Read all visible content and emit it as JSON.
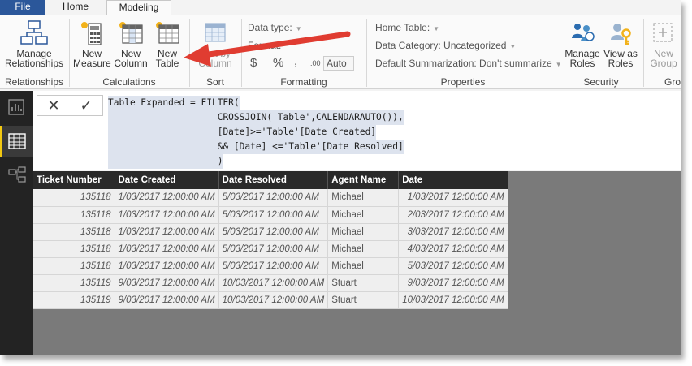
{
  "tabs": {
    "file": "File",
    "home": "Home",
    "modeling": "Modeling"
  },
  "ribbon": {
    "relationships": {
      "btn_line1": "Manage",
      "btn_line2": "Relationships",
      "group": "Relationships"
    },
    "calculations": {
      "new_measure": [
        "New",
        "Measure"
      ],
      "new_column": [
        "New",
        "Column"
      ],
      "new_table": [
        "New",
        "Table"
      ],
      "group": "Calculations"
    },
    "sort": {
      "btn_line1": "Sort by",
      "btn_line2": "Column",
      "group": "Sort"
    },
    "formatting": {
      "data_type": "Data type:",
      "format": "Format:",
      "currency": "$",
      "percent": "%",
      "comma": ",",
      "decimals": ".00",
      "auto": "Auto",
      "group": "Formatting"
    },
    "properties": {
      "home_table": "Home Table:",
      "data_category": "Data Category: Uncategorized",
      "default_summarization": "Default Summarization: Don't summarize",
      "group": "Properties"
    },
    "security": {
      "manage_roles": [
        "Manage",
        "Roles"
      ],
      "view_as_roles": [
        "View as",
        "Roles"
      ],
      "group": "Security"
    },
    "groups": {
      "new_group": [
        "New",
        "Group"
      ],
      "group": "Gro"
    }
  },
  "formula": {
    "cancel": "✕",
    "commit": "✓",
    "lines": [
      "Table Expanded = FILTER(",
      "                    CROSSJOIN('Table',CALENDARAUTO()),",
      "                    [Date]>='Table'[Date Created]",
      "                    && [Date] <='Table'[Date Resolved]",
      "                    )"
    ]
  },
  "table": {
    "headers": [
      "Ticket Number",
      "Date Created",
      "Date Resolved",
      "Agent Name",
      "Date"
    ],
    "rows": [
      [
        "135118",
        "1/03/2017 12:00:00 AM",
        "5/03/2017 12:00:00 AM",
        "Michael",
        "1/03/2017 12:00:00 AM"
      ],
      [
        "135118",
        "1/03/2017 12:00:00 AM",
        "5/03/2017 12:00:00 AM",
        "Michael",
        "2/03/2017 12:00:00 AM"
      ],
      [
        "135118",
        "1/03/2017 12:00:00 AM",
        "5/03/2017 12:00:00 AM",
        "Michael",
        "3/03/2017 12:00:00 AM"
      ],
      [
        "135118",
        "1/03/2017 12:00:00 AM",
        "5/03/2017 12:00:00 AM",
        "Michael",
        "4/03/2017 12:00:00 AM"
      ],
      [
        "135118",
        "1/03/2017 12:00:00 AM",
        "5/03/2017 12:00:00 AM",
        "Michael",
        "5/03/2017 12:00:00 AM"
      ],
      [
        "135119",
        "9/03/2017 12:00:00 AM",
        "10/03/2017 12:00:00 AM",
        "Stuart",
        "9/03/2017 12:00:00 AM"
      ],
      [
        "135119",
        "9/03/2017 12:00:00 AM",
        "10/03/2017 12:00:00 AM",
        "Stuart",
        "10/03/2017 12:00:00 AM"
      ]
    ]
  },
  "colors": {
    "file_tab": "#2b579a",
    "accent": "#f2c811",
    "arrow": "#e03c31",
    "nav_bg": "#232323"
  }
}
